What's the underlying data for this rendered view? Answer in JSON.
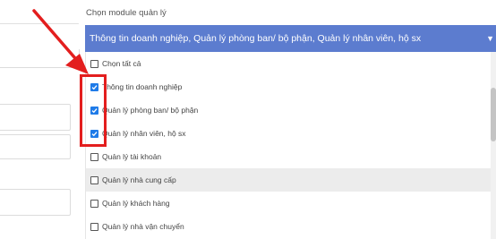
{
  "form": {
    "module_label": "Chọn module quản lý",
    "selected_value": "Thông tin doanh nghiệp, Quản lý phòng ban/ bộ phận, Quản lý nhân viên, hộ sx"
  },
  "options": [
    {
      "label": "Chọn tất cả",
      "checked": false
    },
    {
      "label": "Thông tin doanh nghiệp",
      "checked": true
    },
    {
      "label": "Quản lý phòng ban/ bộ phận",
      "checked": true
    },
    {
      "label": "Quản lý nhân viên, hộ sx",
      "checked": true
    },
    {
      "label": "Quản lý tài khoản",
      "checked": false
    },
    {
      "label": "Quản lý nhà cung cấp",
      "checked": false
    },
    {
      "label": "Quản lý khách hàng",
      "checked": false
    },
    {
      "label": "Quản lý nhà vận chuyển",
      "checked": false
    }
  ],
  "colors": {
    "select_bg": "#5c7ccf",
    "checkbox_checked": "#1f7be8",
    "annotation": "#e31e1e",
    "hover_row": "#ececec"
  },
  "icons": {
    "dropdown": "chevron-down-icon",
    "annotation": "arrow-annotation-icon"
  }
}
